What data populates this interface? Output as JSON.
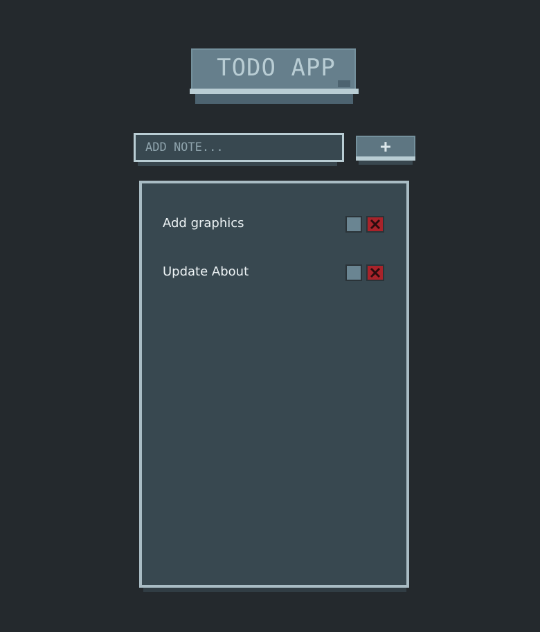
{
  "app": {
    "title": "TODO APP"
  },
  "add_form": {
    "input_placeholder": "ADD NOTE...",
    "input_value": "",
    "add_icon": "plus-icon"
  },
  "todos": [
    {
      "label": "Add graphics",
      "checked": false,
      "delete_icon": "close-icon"
    },
    {
      "label": "Update About",
      "checked": false,
      "delete_icon": "close-icon"
    }
  ],
  "colors": {
    "background": "#24292d",
    "panel": "#384850",
    "panel_border": "#a9bcc4",
    "button_face": "#667f8c",
    "checkbox": "#6a8592",
    "delete": "#a8232a",
    "text": "#eef4f6"
  }
}
